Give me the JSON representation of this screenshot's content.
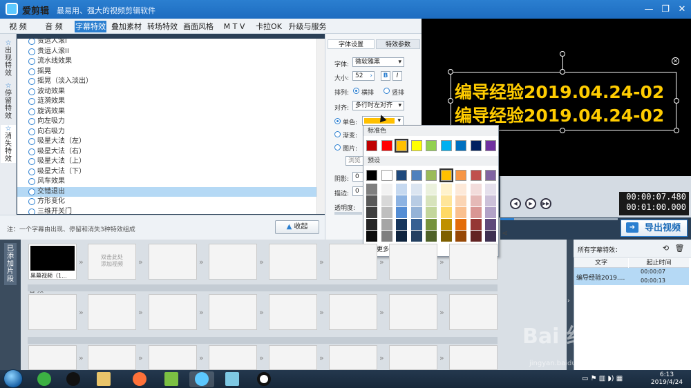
{
  "app": {
    "name": "爱剪辑",
    "slogan": "最易用、强大的视频剪辑软件"
  },
  "window_controls": {
    "minimize": "—",
    "maximize": "❐",
    "close": "✕"
  },
  "menu": [
    "视 频",
    "音 频",
    "字幕特效",
    "叠加素材",
    "转场特效",
    "画面风格",
    "M T V",
    "卡拉OK",
    "升级与服务"
  ],
  "left_tabs": [
    {
      "label": "出现特效",
      "icon": "star-icon"
    },
    {
      "label": "停留特效",
      "icon": "star-icon"
    },
    {
      "label": "消失特效",
      "icon": "star-icon"
    }
  ],
  "effects": [
    "贵运人滚I",
    "贵运人滚II",
    "流水线效果",
    "摇晃",
    "摇晃（淡入淡出）",
    "波动效果",
    "涟漪效果",
    "旋涡效果",
    "向左吸力",
    "向右吸力",
    "吸星大法（左）",
    "吸星大法（右）",
    "吸星大法（上）",
    "吸星大法（下）",
    "风车效果",
    "交错退出",
    "方形变化",
    "三维开关门"
  ],
  "selected_effect": "交错退出",
  "footnote": "注：一个字幕由出现、停留和消失3种特效组成",
  "collapse_label": "收起",
  "settings": {
    "tabs": [
      "字体设置",
      "特效参数"
    ],
    "font_label": "字体:",
    "font_value": "微软雅黑",
    "size_label": "大小:",
    "size_value": "52",
    "bold": "B",
    "italic": "I",
    "arrange_label": "排列:",
    "arrange_h": "横排",
    "arrange_v": "竖排",
    "align_label": "对齐:",
    "align_value": "多行时左对齐",
    "solid_label": "单色:",
    "gradient_label": "渐变:",
    "image_label": "图片:",
    "browse": "浏览",
    "shadow_label": "阴影:",
    "shadow_value": "0",
    "stroke_label": "描边:",
    "stroke_value": "0",
    "opacity_label": "透明度:",
    "solid_color": "#ffc000"
  },
  "color_popup": {
    "standard_title": "标准色",
    "standard": [
      "#c00000",
      "#ff0000",
      "#ffc000",
      "#ffff00",
      "#92d050",
      "#00b0f0",
      "#0070c0",
      "#002060",
      "#7030a0"
    ],
    "preset_title": "预设",
    "preset_top": [
      "#000000",
      "#ffffff",
      "#1f497d",
      "#4f81bd",
      "#9bbb59",
      "#ffc000",
      "#f79646",
      "#c0504d",
      "#8064a2"
    ],
    "preset_columns": [
      [
        "#7f7f7f",
        "#595959",
        "#3f3f3f",
        "#262626",
        "#0c0c0c"
      ],
      [
        "#f2f2f2",
        "#d8d8d8",
        "#bfbfbf",
        "#a5a5a5",
        "#7f7f7f"
      ],
      [
        "#c6d9f0",
        "#8db3e2",
        "#548dd4",
        "#17365d",
        "#0f243e"
      ],
      [
        "#dbe5f1",
        "#b8cce4",
        "#95b3d7",
        "#366092",
        "#244061"
      ],
      [
        "#ebf1dd",
        "#d7e3bc",
        "#c3d69b",
        "#76923c",
        "#4f6128"
      ],
      [
        "#fff2cc",
        "#ffe599",
        "#ffd966",
        "#bf9000",
        "#7f6000"
      ],
      [
        "#fde9d9",
        "#fbd5b5",
        "#fac08f",
        "#e36c09",
        "#974806"
      ],
      [
        "#f2dcdb",
        "#e5b9b7",
        "#d99694",
        "#953734",
        "#632423"
      ],
      [
        "#e5e0ec",
        "#ccc1d9",
        "#b2a2c7",
        "#5f497a",
        "#3f3151"
      ]
    ],
    "more_colors": "更多颜色..."
  },
  "preview": {
    "subtitle_lines": [
      "编导经验2019.04.24-02",
      "编导经验2019.04.24-02"
    ],
    "subtitle_color": "#ffcc00"
  },
  "playback": {
    "current_time": "00:00:07.480",
    "total_time": "00:01:00.000",
    "prev_icon": "◀",
    "play_icon": "▶",
    "next_icon": "▶▶",
    "progress_fraction": 0.12
  },
  "export_label": "导出视频",
  "added_clips_tab": "已添加片段",
  "timeline": {
    "first_clip_label": "黑幕视频（1...",
    "placeholder": "双击此处\n添加视频",
    "audio_lane": "音 频"
  },
  "subtitle_panel": {
    "title": "所有字幕特效：",
    "col_text": "文字",
    "col_time": "起止时间",
    "row_text": "编导经验2019....",
    "row_start": "00:00:07",
    "row_end": "00:00:13"
  },
  "taskbar": {
    "time": "6:13",
    "date": "2019/4/24"
  },
  "watermark": "Bai 经验",
  "watermark_url": "jingyan.baidu.com"
}
